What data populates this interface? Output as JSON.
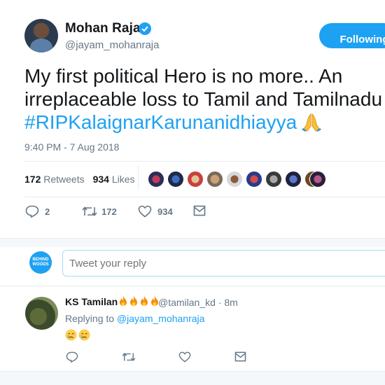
{
  "author": {
    "name": "Mohan Raja",
    "handle": "@jayam_mohanraja",
    "follow_label": "Following"
  },
  "tweet": {
    "text_line1": "My first political Hero is no more.. An",
    "text_line2": "irreplaceable loss to Tamil and Tamilnadu",
    "hashtag": "#RIPKalaignarKarunanidhiayya",
    "timestamp": "9:40 PM - 7 Aug 2018"
  },
  "stats": {
    "retweets_count": "172",
    "retweets_label": "Retweets",
    "likes_count": "934",
    "likes_label": "Likes"
  },
  "actions": {
    "reply_count": "2",
    "retweet_count": "172",
    "like_count": "934"
  },
  "reply_box": {
    "logo_text": "BEHIND WOODS",
    "placeholder": "Tweet your reply"
  },
  "reply": {
    "name": "KS Tamilan",
    "handle_time": "@tamilan_kd · 8m",
    "replying_prefix": "Replying to",
    "replying_to": "@jayam_mohanraja"
  },
  "colors": {
    "accent": "#1da1f2",
    "muted": "#657786",
    "text": "#14171a"
  }
}
